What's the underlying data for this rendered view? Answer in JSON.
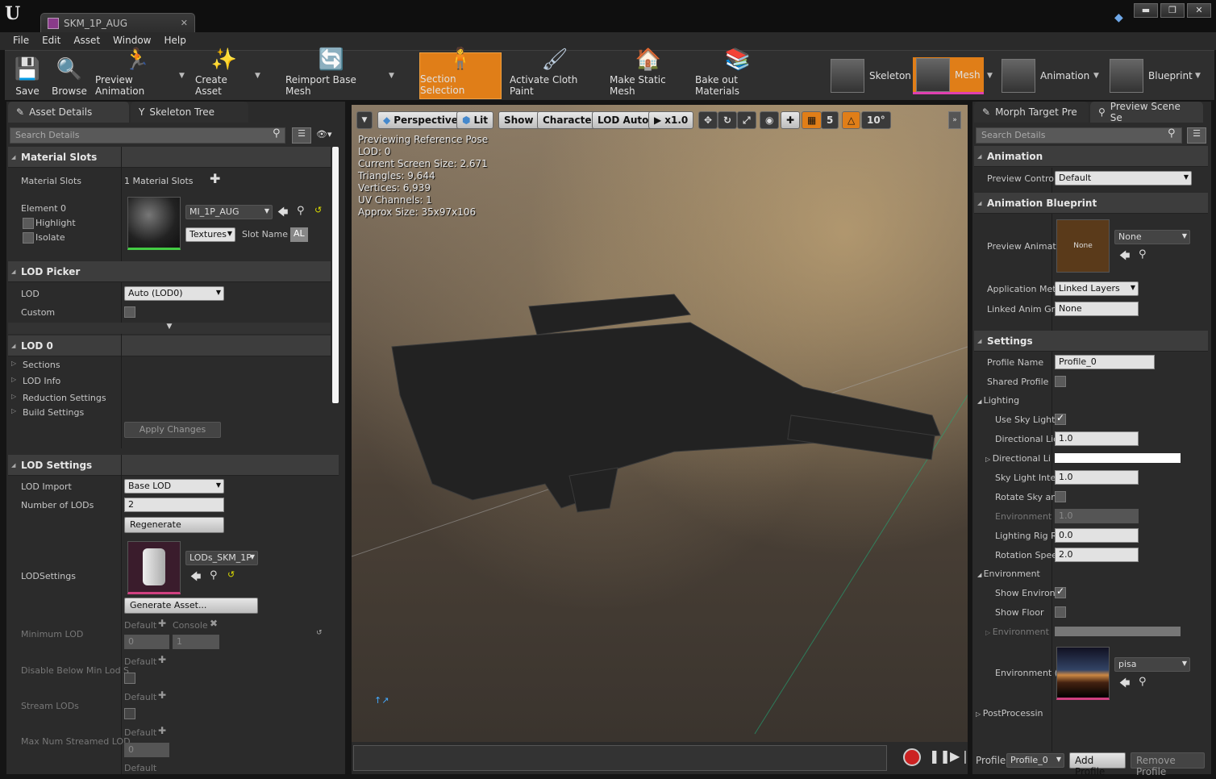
{
  "window": {
    "tab_title": "SKM_1P_AUG",
    "min": "▬",
    "max": "❐",
    "close": "✕"
  },
  "menu": [
    "File",
    "Edit",
    "Asset",
    "Window",
    "Help"
  ],
  "toolbar": {
    "save": "Save",
    "browse": "Browse",
    "preview_animation": "Preview Animation",
    "create_asset": "Create Asset",
    "reimport": "Reimport Base Mesh",
    "section_selection": "Section Selection",
    "cloth_paint": "Activate Cloth Paint",
    "make_static": "Make Static Mesh",
    "bake_materials": "Bake out Materials",
    "modes": {
      "skeleton": "Skeleton",
      "mesh": "Mesh",
      "animation": "Animation",
      "blueprint": "Blueprint"
    }
  },
  "left": {
    "tabs": {
      "asset_details": "Asset Details",
      "skeleton_tree": "Skeleton Tree"
    },
    "search_placeholder": "Search Details",
    "material_slots": {
      "header": "Material Slots",
      "label": "Material Slots",
      "count": "1 Material Slots",
      "element": "Element 0",
      "highlight": "Highlight",
      "isolate": "Isolate",
      "material": "MI_1P_AUG",
      "textures": "Textures",
      "slot_name_label": "Slot Name",
      "slot_name": "AL"
    },
    "lod_picker": {
      "header": "LOD Picker",
      "lod_label": "LOD",
      "lod_value": "Auto (LOD0)",
      "custom": "Custom"
    },
    "lod0": {
      "header": "LOD 0",
      "items": [
        "Sections",
        "LOD Info",
        "Reduction Settings",
        "Build Settings"
      ],
      "apply": "Apply Changes"
    },
    "lod_settings": {
      "header": "LOD Settings",
      "lod_import": "LOD Import",
      "lod_import_value": "Base LOD",
      "num_lods": "Number of LODs",
      "num_lods_value": "2",
      "regenerate": "Regenerate",
      "lodsettings": "LODSettings",
      "lods_asset": "LODs_SKM_1P",
      "generate": "Generate Asset...",
      "min_lod": "Minimum LOD",
      "default": "Default",
      "console": "Console",
      "min_default": "0",
      "min_console": "1",
      "disable_below": "Disable Below Min Lod S",
      "stream_lods": "Stream LODs",
      "max_streamed": "Max Num Streamed LOD",
      "max_value": "0"
    }
  },
  "viewport": {
    "perspective": "Perspective",
    "lit": "Lit",
    "show": "Show",
    "character": "Character",
    "lod_auto": "LOD Auto",
    "speed": "x1.0",
    "grid": "5",
    "angle": "10°",
    "info": [
      "Previewing Reference Pose",
      "LOD: 0",
      "Current Screen Size: 2.671",
      "Triangles: 9,644",
      "Vertices: 6,939",
      "UV Channels: 1",
      "Approx Size: 35x97x106"
    ]
  },
  "right": {
    "tabs": {
      "morph": "Morph Target Pre",
      "scene": "Preview Scene Se"
    },
    "search_placeholder": "Search Details",
    "animation": {
      "header": "Animation",
      "preview_controller": "Preview Contro",
      "preview_controller_value": "Default"
    },
    "anim_bp": {
      "header": "Animation Blueprint",
      "preview_anim": "Preview Animat",
      "thumb_label": "None",
      "value": "None",
      "app_method": "Application Met",
      "app_method_value": "Linked Layers",
      "linked": "Linked Anim Gra",
      "linked_value": "None"
    },
    "settings": {
      "header": "Settings",
      "profile_name": "Profile Name",
      "profile_value": "Profile_0",
      "shared": "Shared Profile",
      "lighting": "Lighting",
      "use_sky": "Use Sky Light",
      "dir_intensity": "Directional Lic",
      "dir_intensity_value": "1.0",
      "dir_color": "Directional Li",
      "sky_intensity": "Sky Light Inte",
      "sky_intensity_value": "1.0",
      "rotate_sky": "Rotate Sky an",
      "env_intensity": "Environment I",
      "env_intensity_value": "1.0",
      "rig_rotation": "Lighting Rig R",
      "rig_rotation_value": "0.0",
      "rotation_speed": "Rotation Spee",
      "rotation_speed_value": "2.0",
      "environment": "Environment",
      "show_env": "Show Environ",
      "show_floor": "Show Floor",
      "env_color": "Environment",
      "env_cube": "Environment (",
      "env_cube_value": "pisa",
      "postprocessing": "PostProcessin"
    },
    "footer": {
      "profile": "Profile",
      "profile_value": "Profile_0",
      "add": "Add Profile",
      "remove": "Remove Profile"
    }
  }
}
